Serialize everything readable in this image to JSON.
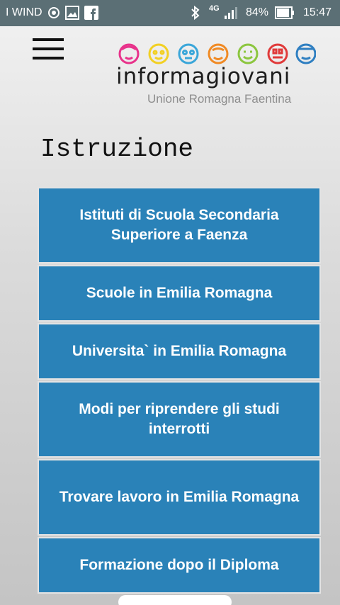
{
  "status_bar": {
    "carrier": "I WIND",
    "network": "4G",
    "battery": "84%",
    "time": "15:47",
    "icons": [
      "hotspot-icon",
      "gallery-icon",
      "facebook-icon",
      "bluetooth-icon",
      "signal-icon",
      "battery-icon"
    ]
  },
  "header": {
    "menu_icon": "hamburger-menu-icon",
    "logo": {
      "brand": "informagiovani",
      "subtitle": "Unione Romagna Faentina",
      "face_colors": [
        "#e8338b",
        "#f2d024",
        "#3aa6d9",
        "#f08a24",
        "#8cc63f",
        "#e03a3a",
        "#2f7fc1"
      ]
    }
  },
  "page": {
    "title": "Istruzione"
  },
  "menu_items": [
    {
      "label": "Istituti di Scuola Secondaria Superiore a Faenza"
    },
    {
      "label": "Scuole in Emilia Romagna"
    },
    {
      "label": "Universita` in Emilia Romagna"
    },
    {
      "label": "Modi per riprendere gli studi interrotti"
    },
    {
      "label": "Trovare lavoro in Emilia Romagna"
    },
    {
      "label": "Formazione dopo il Diploma"
    }
  ],
  "colors": {
    "button_bg": "#2a82b8",
    "status_bar_bg": "#5b6f75"
  }
}
